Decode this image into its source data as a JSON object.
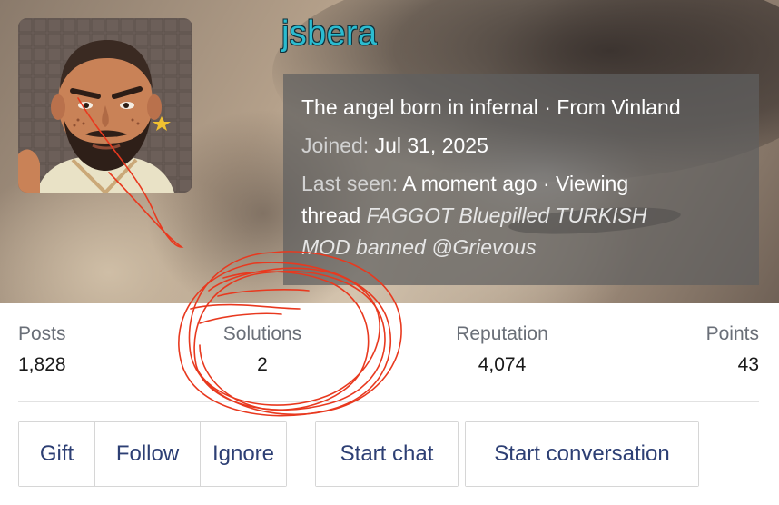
{
  "profile": {
    "username": "jsbera",
    "tagline": "The angel born in infernal · From Vinland",
    "joined_label": "Joined:",
    "joined_value": "Jul 31, 2025",
    "last_seen_label": "Last seen:",
    "last_seen_value": "A moment ago · Viewing",
    "last_seen_thread_prefix": "thread",
    "last_seen_thread_title_line1": "FAGGOT Bluepilled TURKISH",
    "last_seen_thread_title_line2": "MOD banned @Grievous"
  },
  "stats": {
    "posts": {
      "label": "Posts",
      "value": "1,828"
    },
    "solutions": {
      "label": "Solutions",
      "value": "2"
    },
    "reputation": {
      "label": "Reputation",
      "value": "4,074"
    },
    "points": {
      "label": "Points",
      "value": "43"
    }
  },
  "actions": {
    "gift": "Gift",
    "follow": "Follow",
    "ignore": "Ignore",
    "start_chat": "Start chat",
    "start_conversation": "Start conversation"
  },
  "colors": {
    "username": "#2bbcd0",
    "button_text": "#2d3f74",
    "annotation": "#e8391f"
  }
}
